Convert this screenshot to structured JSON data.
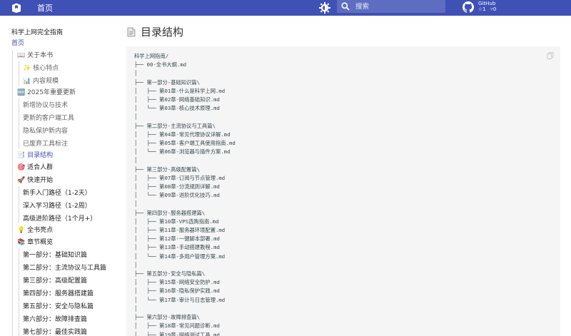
{
  "header": {
    "title": "首页",
    "search_placeholder": "搜索",
    "repo_name": "GitHub",
    "stars": "☆1",
    "forks": "⑂0",
    "brand_color": "#4051b5"
  },
  "sidebar": {
    "title": "科学上网完全指南",
    "items": [
      {
        "label": "首页"
      },
      {
        "label": "📖 关于本书"
      },
      {
        "label": "✨ 核心特点"
      },
      {
        "label": "📊 内容规模"
      },
      {
        "label": "🆕 2025年重要更新"
      },
      {
        "label": "新增协议与技术"
      },
      {
        "label": "更新的客户端工具"
      },
      {
        "label": "隐私保护新内容"
      },
      {
        "label": "已废弃工具标注"
      },
      {
        "label": "📑 目录结构"
      },
      {
        "label": "🎯 适合人群"
      },
      {
        "label": "🚀 快速开始"
      },
      {
        "label": "新手入门路径（1-2天）"
      },
      {
        "label": "深入学习路径（1-2周）"
      },
      {
        "label": "高级进阶路径（1个月+）"
      },
      {
        "label": "💡 全书亮点"
      },
      {
        "label": "📚 章节概览"
      },
      {
        "label": "第一部分：基础知识篇"
      },
      {
        "label": "第二部分：主流协议与工具篇"
      },
      {
        "label": "第三部分：高级配置篇"
      },
      {
        "label": "第四部分：服务器搭建篇"
      },
      {
        "label": "第五部分：安全与隐私篇"
      },
      {
        "label": "第六部分：故障排查篇"
      },
      {
        "label": "第七部分：最佳实践篇"
      }
    ]
  },
  "main": {
    "title": "目录结构",
    "tree": [
      "科学上网指南/",
      "├── 00-全书大纲.md",
      "│",
      "├── 第一部分-基础知识篇\\",
      "│   ├── 第01章-什么是科学上网.md",
      "│   ├── 第02章-网络基础知识.md",
      "│   └── 第03章-核心技术原理.md",
      "│",
      "├── 第二部分-主流协议与工具篇\\",
      "│   ├── 第04章-常见代理协议详解.md",
      "│   ├── 第05章-客户端工具使用指南.md",
      "│   └── 第06章-浏览器与插件方案.md",
      "│",
      "├── 第三部分-高级配置篇\\",
      "│   ├── 第07章-订阅与节点管理.md",
      "│   ├── 第08章-分流规则详解.md",
      "│   └── 第09章-进阶优化技巧.md",
      "│",
      "├── 第四部分-服务器搭建篇\\",
      "│   ├── 第10章-VPS选购指南.md",
      "│   ├── 第11章-服务器环境配置.md",
      "│   ├── 第12章-一键脚本部署.md",
      "│   ├── 第13章-手动搭建教程.md",
      "│   └── 第14章-多用户管理方案.md",
      "│",
      "├── 第五部分-安全与隐私篇\\",
      "│   ├── 第15章-网络安全防护.md",
      "│   ├── 第16章-隐私保护实践.md",
      "│   └── 第17章-审计与日志管理.md",
      "│",
      "├── 第六部分-故障排查篇\\",
      "│   ├── 第18章-常见问题诊断.md",
      "│   ├── 第19章-网络测试工具.md"
    ]
  }
}
